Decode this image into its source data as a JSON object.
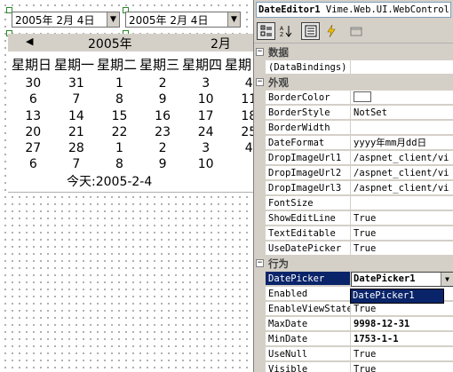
{
  "designer": {
    "picker1": {
      "value": "2005年  2月  4日"
    },
    "picker2": {
      "value": "2005年  2月  4日"
    },
    "calendar": {
      "prev_arrow": "◀",
      "year": "2005年",
      "month": "2月",
      "weekdays": [
        "星期日",
        "星期一",
        "星期二",
        "星期三",
        "星期四",
        "星期"
      ],
      "rows": [
        [
          "30",
          "31",
          "1",
          "2",
          "3",
          "4"
        ],
        [
          "6",
          "7",
          "8",
          "9",
          "10",
          "11"
        ],
        [
          "13",
          "14",
          "15",
          "16",
          "17",
          "18"
        ],
        [
          "20",
          "21",
          "22",
          "23",
          "24",
          "25"
        ],
        [
          "27",
          "28",
          "1",
          "2",
          "3",
          "4"
        ],
        [
          "6",
          "7",
          "8",
          "9",
          "10",
          ""
        ]
      ],
      "today": "今天:2005-2-4"
    }
  },
  "properties": {
    "object_selector": {
      "name": "DateEditor1",
      "type": "Vime.Web.UI.WebControl"
    },
    "toolbar": [
      "categorized-icon",
      "alphabetical-icon",
      "properties-icon",
      "events-icon",
      "property-pages-icon"
    ],
    "categories": {
      "data": "数据",
      "appearance": "外观",
      "behavior": "行为"
    },
    "rows": {
      "databindings": {
        "name": "(DataBindings)",
        "value": ""
      },
      "bordercolor": {
        "name": "BorderColor",
        "value": ""
      },
      "borderstyle": {
        "name": "BorderStyle",
        "value": "NotSet"
      },
      "borderwidth": {
        "name": "BorderWidth",
        "value": ""
      },
      "dateformat": {
        "name": "DateFormat",
        "value": "yyyy年mm月dd日"
      },
      "dropimageurl1": {
        "name": "DropImageUrl1",
        "value": "/aspnet_client/vi"
      },
      "dropimageurl2": {
        "name": "DropImageUrl2",
        "value": "/aspnet_client/vi"
      },
      "dropimageurl3": {
        "name": "DropImageUrl3",
        "value": "/aspnet_client/vi"
      },
      "fontsize": {
        "name": "FontSize",
        "value": ""
      },
      "showeditline": {
        "name": "ShowEditLine",
        "value": "True"
      },
      "texteditable": {
        "name": "TextEditable",
        "value": "True"
      },
      "usedatepicker": {
        "name": "UseDatePicker",
        "value": "True"
      },
      "datepicker": {
        "name": "DatePicker",
        "value": "DatePicker1"
      },
      "enabled": {
        "name": "Enabled",
        "value": ""
      },
      "enableviewstate": {
        "name": "EnableViewState",
        "value": "True"
      },
      "maxdate": {
        "name": "MaxDate",
        "value": "9998-12-31"
      },
      "mindate": {
        "name": "MinDate",
        "value": "1753-1-1"
      },
      "usenull": {
        "name": "UseNull",
        "value": "True"
      },
      "visible": {
        "name": "Visible",
        "value": "True"
      }
    },
    "dropdown_option": "DatePicker1"
  },
  "colors": {
    "selection": "#0a246a",
    "panel": "#d4d0c8",
    "handle": "#2a8a2a"
  }
}
